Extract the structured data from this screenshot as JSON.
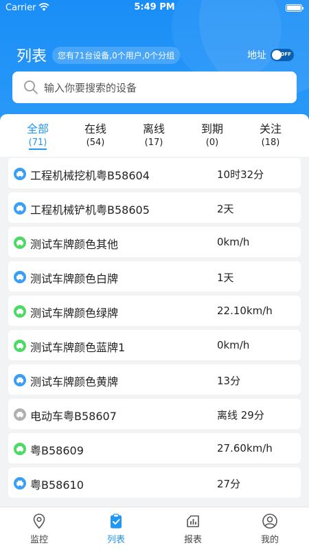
{
  "status_bar": {
    "carrier": "Carrier",
    "time": "5:49 PM"
  },
  "header": {
    "title": "列表",
    "summary": "您有71台设备,0个用户,0个分组",
    "address_label": "地址",
    "toggle_text": "OFF"
  },
  "search": {
    "placeholder": "输入你要搜索的设备"
  },
  "tabs": [
    {
      "label": "全部",
      "count": "(71)",
      "active": true
    },
    {
      "label": "在线",
      "count": "(54)"
    },
    {
      "label": "离线",
      "count": "(17)"
    },
    {
      "label": "到期",
      "count": "(0)"
    },
    {
      "label": "关注",
      "count": "(18)"
    }
  ],
  "colors": {
    "primary": "#2196f3",
    "online": "#4cd964",
    "blue_status": "#3b9ef5",
    "offline": "#b0b0b0"
  },
  "devices": [
    {
      "name": "工程机械挖机粤B58604",
      "value": "10时32分",
      "status": "blue"
    },
    {
      "name": "工程机械铲机粤B58605",
      "value": "2天",
      "status": "blue"
    },
    {
      "name": "测试车牌颜色其他",
      "value": "0km/h",
      "status": "green"
    },
    {
      "name": "测试车牌颜色白牌",
      "value": "1天",
      "status": "blue"
    },
    {
      "name": "测试车牌颜色绿牌",
      "value": "22.10km/h",
      "status": "green"
    },
    {
      "name": "测试车牌颜色蓝牌1",
      "value": "0km/h",
      "status": "green"
    },
    {
      "name": "测试车牌颜色黄牌",
      "value": "13分",
      "status": "blue"
    },
    {
      "name": "电动车粤B58607",
      "value": "离线 29分",
      "status": "gray"
    },
    {
      "name": "粤B58609",
      "value": "27.60km/h",
      "status": "green"
    },
    {
      "name": "粤B58610",
      "value": "27分",
      "status": "blue"
    }
  ],
  "bottom_nav": [
    {
      "label": "监控",
      "icon": "location-pin-icon"
    },
    {
      "label": "列表",
      "icon": "clipboard-check-icon",
      "active": true
    },
    {
      "label": "报表",
      "icon": "report-chart-icon"
    },
    {
      "label": "我的",
      "icon": "user-profile-icon"
    }
  ]
}
